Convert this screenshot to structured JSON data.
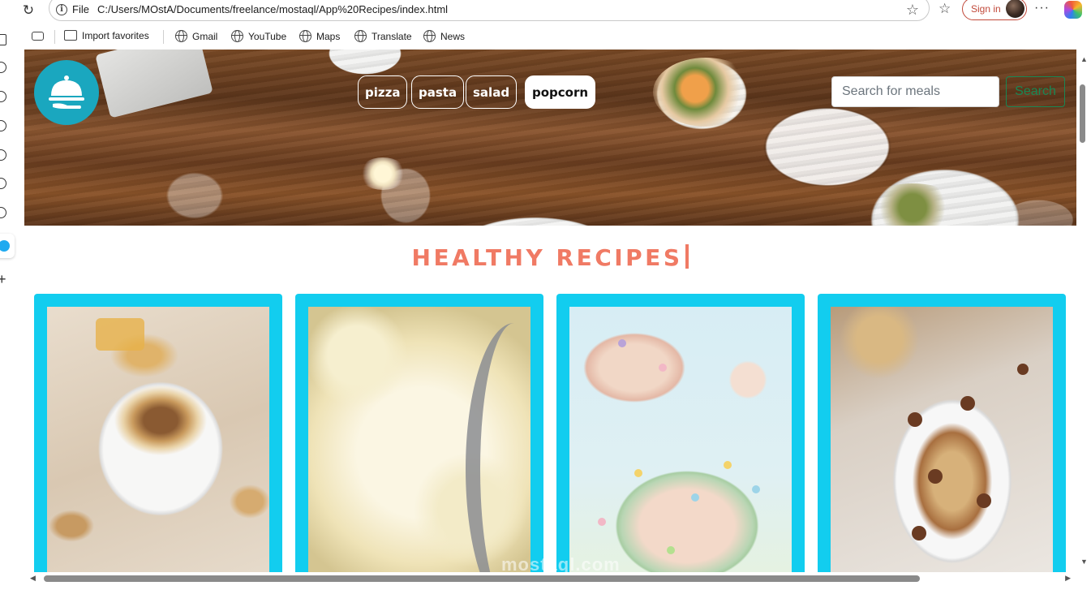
{
  "browser": {
    "scheme_label": "File",
    "url": "C:/Users/MOstA/Documents/freelance/mostaql/App%20Recipes/index.html",
    "signin_label": "Sign in",
    "more_label": "···"
  },
  "bookmarks": [
    {
      "label": "Import favorites",
      "icon": "import-icon"
    },
    {
      "label": "Gmail",
      "icon": "globe-icon"
    },
    {
      "label": "YouTube",
      "icon": "globe-icon"
    },
    {
      "label": "Maps",
      "icon": "globe-icon"
    },
    {
      "label": "Translate",
      "icon": "globe-icon"
    },
    {
      "label": "News",
      "icon": "globe-icon"
    }
  ],
  "page": {
    "categories": [
      {
        "label": "pizza",
        "active": false
      },
      {
        "label": "pasta",
        "active": false
      },
      {
        "label": "salad",
        "active": false
      },
      {
        "label": "popcorn",
        "active": true
      }
    ],
    "search": {
      "placeholder": "Search for meals",
      "button_label": "Search"
    },
    "section_title": "HEALTHY RECIPES",
    "logo_icon": "serving-cloche-icon",
    "recipes": [
      {
        "image": "caramel-candy-popcorn-photo"
      },
      {
        "image": "buttered-popcorn-bowl-photo"
      },
      {
        "image": "easter-egg-candy-popcorn-photo"
      },
      {
        "image": "peanut-butter-cup-popcorn-photo"
      }
    ]
  },
  "colors": {
    "accent_title": "#f07a64",
    "card_border": "#12cdef",
    "logo_bg": "#1aa7bf",
    "search_button": "#198754"
  },
  "watermark": "mostaql.com"
}
